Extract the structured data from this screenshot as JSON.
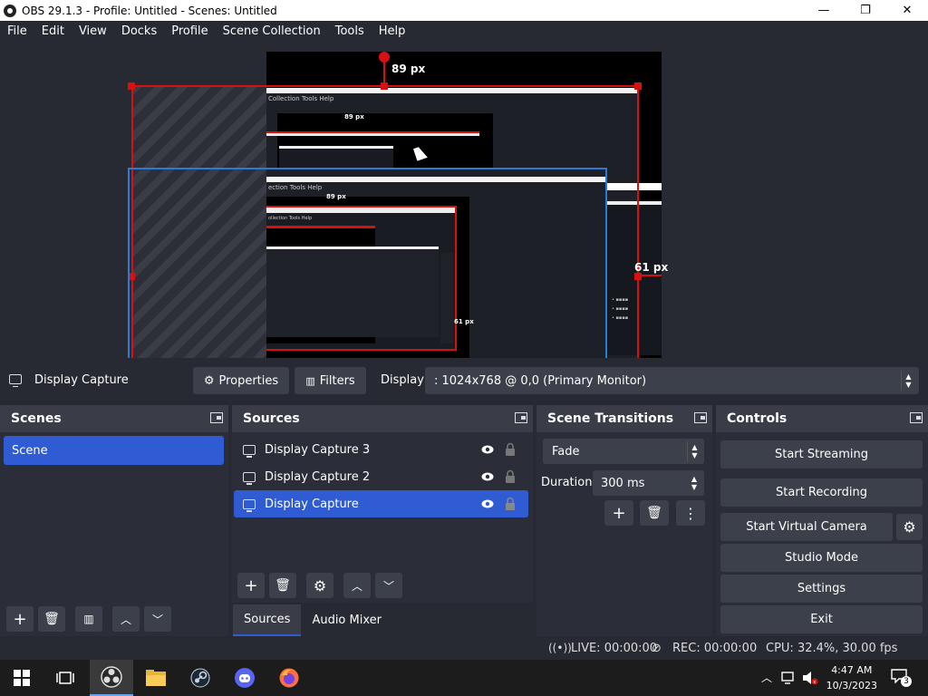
{
  "window": {
    "title": "OBS 29.1.3 - Profile: Untitled - Scenes: Untitled",
    "minimize": "—",
    "maximize": "❐",
    "close": "✕"
  },
  "menu": [
    "File",
    "Edit",
    "View",
    "Docks",
    "Profile",
    "Scene Collection",
    "Tools",
    "Help"
  ],
  "preview": {
    "measure_top": "89 px",
    "measure_right": "61 px",
    "nested_menu_1": "Collection    Tools    Help",
    "nested_menu_2": "ection    Tools    Help",
    "nested_menu_3": "ollection  Tools  Help",
    "nested_label_1": "89 px",
    "nested_label_2": "89 px",
    "nested_label_3": "61 px"
  },
  "source_toolbar": {
    "selected_source": "Display Capture",
    "properties_label": "Properties",
    "filters_label": "Filters",
    "display_label": "Display",
    "display_value": ": 1024x768 @ 0,0 (Primary Monitor)"
  },
  "scenes": {
    "title": "Scenes",
    "items": [
      "Scene"
    ]
  },
  "sources": {
    "title": "Sources",
    "items": [
      "Display Capture 3",
      "Display Capture 2",
      "Display Capture"
    ]
  },
  "tabs": [
    "Sources",
    "Audio Mixer"
  ],
  "transitions": {
    "title": "Scene Transitions",
    "selected": "Fade",
    "duration_label": "Duration",
    "duration_value": "300 ms"
  },
  "controls": {
    "title": "Controls",
    "start_streaming": "Start Streaming",
    "start_recording": "Start Recording",
    "start_virtual_camera": "Start Virtual Camera",
    "studio_mode": "Studio Mode",
    "settings": "Settings",
    "exit": "Exit"
  },
  "status": {
    "live": "LIVE: 00:00:00",
    "rec": "REC: 00:00:00",
    "cpu": "CPU: 32.4%, 30.00 fps"
  },
  "taskbar": {
    "time": "4:47 AM",
    "date": "10/3/2023",
    "notifications": "3"
  }
}
